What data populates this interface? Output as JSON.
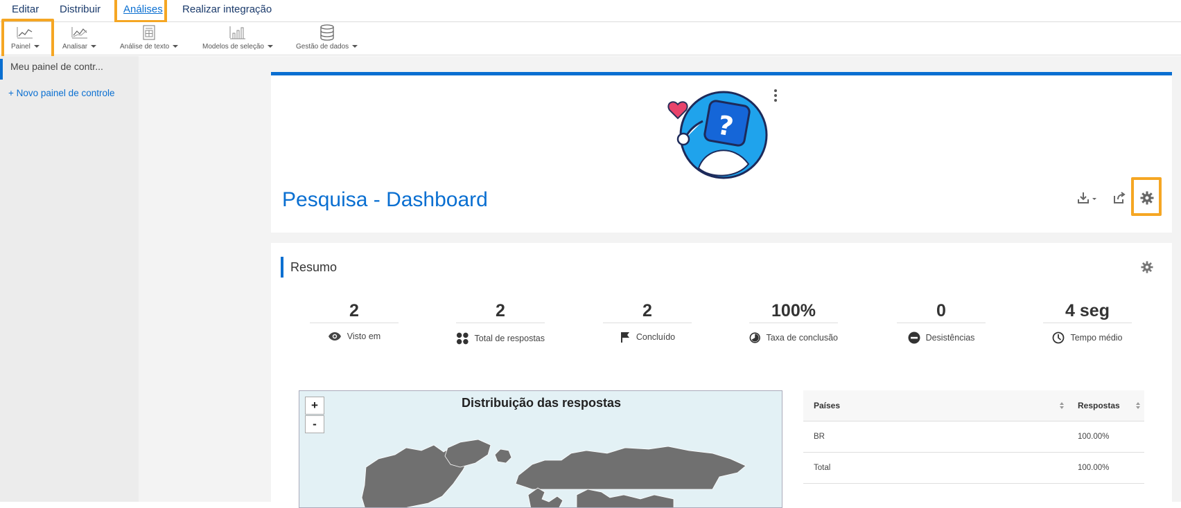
{
  "topnav": {
    "items": [
      {
        "label": "Editar"
      },
      {
        "label": "Distribuir"
      },
      {
        "label": "Análises"
      },
      {
        "label": "Realizar integração"
      }
    ]
  },
  "toolbar": {
    "items": [
      {
        "label": "Painel",
        "icon": "line-chart-icon"
      },
      {
        "label": "Analisar",
        "icon": "trend-chart-icon"
      },
      {
        "label": "Análise de texto",
        "icon": "text-analysis-icon"
      },
      {
        "label": "Modelos de seleção",
        "icon": "bar-chart-icon"
      },
      {
        "label": "Gestão de dados",
        "icon": "database-icon"
      }
    ]
  },
  "sidebar": {
    "current": "Meu painel de contr...",
    "new_label": "+ Novo painel de controle"
  },
  "dashboard": {
    "title": "Pesquisa - Dashboard"
  },
  "summary": {
    "title": "Resumo",
    "stats": [
      {
        "value": "2",
        "label": "Visto em",
        "icon": "eye-icon"
      },
      {
        "value": "2",
        "label": "Total de respostas",
        "icon": "grid-dots-icon"
      },
      {
        "value": "2",
        "label": "Concluído",
        "icon": "flag-icon"
      },
      {
        "value": "100%",
        "label": "Taxa de conclusão",
        "icon": "pie-icon"
      },
      {
        "value": "0",
        "label": "Desistências",
        "icon": "minus-circle-icon"
      },
      {
        "value": "4 seg",
        "label": "Tempo médio",
        "icon": "clock-icon"
      }
    ]
  },
  "map": {
    "title": "Distribuição das respostas",
    "zoom_in": "+",
    "zoom_out": "-"
  },
  "table": {
    "headers": [
      "Países",
      "Respostas"
    ],
    "rows": [
      [
        "BR",
        "100.00%"
      ],
      [
        "Total",
        "100.00%"
      ]
    ]
  },
  "colors": {
    "accent": "#0a6fd1",
    "highlight": "#f5a623",
    "nav_text": "#1a3a6b"
  }
}
